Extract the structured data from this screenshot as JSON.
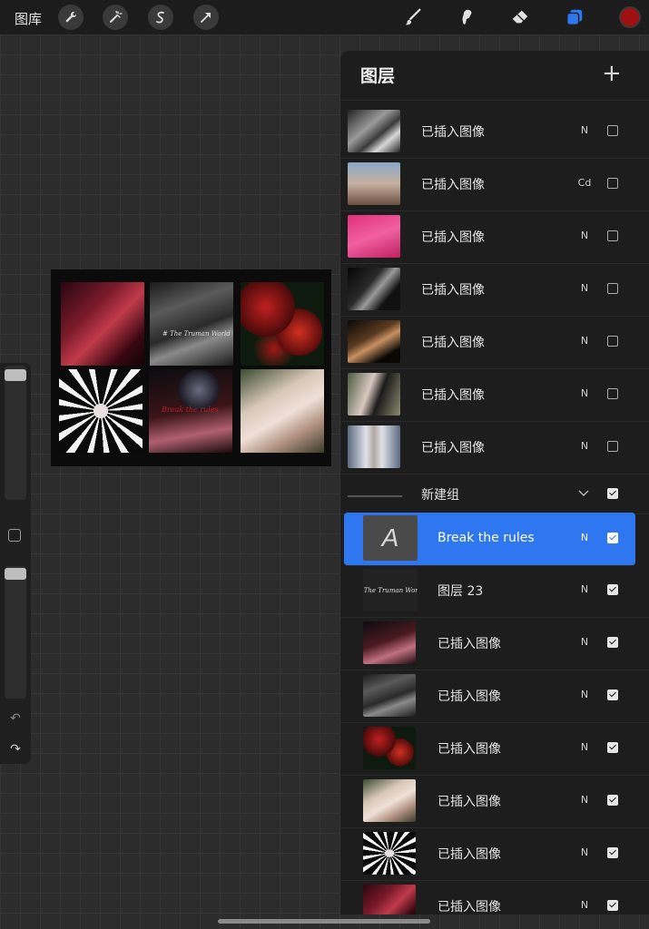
{
  "topbar": {
    "gallery_label": "图库",
    "left_tools": [
      "wrench-icon",
      "magic-wand-icon",
      "selection-s-icon",
      "arrow-transform-icon"
    ],
    "right_tools": [
      "brush-icon",
      "smudge-icon",
      "eraser-icon",
      "layers-icon"
    ],
    "active_color": "#a11010"
  },
  "artwork": {
    "caption": "# The Truman World",
    "caption2": "Break the rules"
  },
  "layers_panel": {
    "title": "图层",
    "add_label": "+",
    "layers": [
      {
        "name": "已插入图像",
        "mode": "N",
        "visible": false
      },
      {
        "name": "已插入图像",
        "mode": "Cd",
        "visible": false
      },
      {
        "name": "已插入图像",
        "mode": "N",
        "visible": false
      },
      {
        "name": "已插入图像",
        "mode": "N",
        "visible": false
      },
      {
        "name": "已插入图像",
        "mode": "N",
        "visible": false
      },
      {
        "name": "已插入图像",
        "mode": "N",
        "visible": false
      },
      {
        "name": "已插入图像",
        "mode": "N",
        "visible": false
      }
    ],
    "group": {
      "name": "新建组",
      "visible": true
    },
    "group_layers": [
      {
        "name": "Break the rules",
        "mode": "N",
        "visible": true,
        "active": true,
        "type": "text"
      },
      {
        "name": "图层 23",
        "mode": "N",
        "visible": true,
        "thumb_text": "# The Truman World"
      },
      {
        "name": "已插入图像",
        "mode": "N",
        "visible": true
      },
      {
        "name": "已插入图像",
        "mode": "N",
        "visible": true
      },
      {
        "name": "已插入图像",
        "mode": "N",
        "visible": true
      },
      {
        "name": "已插入图像",
        "mode": "N",
        "visible": true
      },
      {
        "name": "已插入图像",
        "mode": "N",
        "visible": true
      },
      {
        "name": "已插入图像",
        "mode": "N",
        "visible": true
      }
    ]
  },
  "text_thumb_glyph": "A"
}
